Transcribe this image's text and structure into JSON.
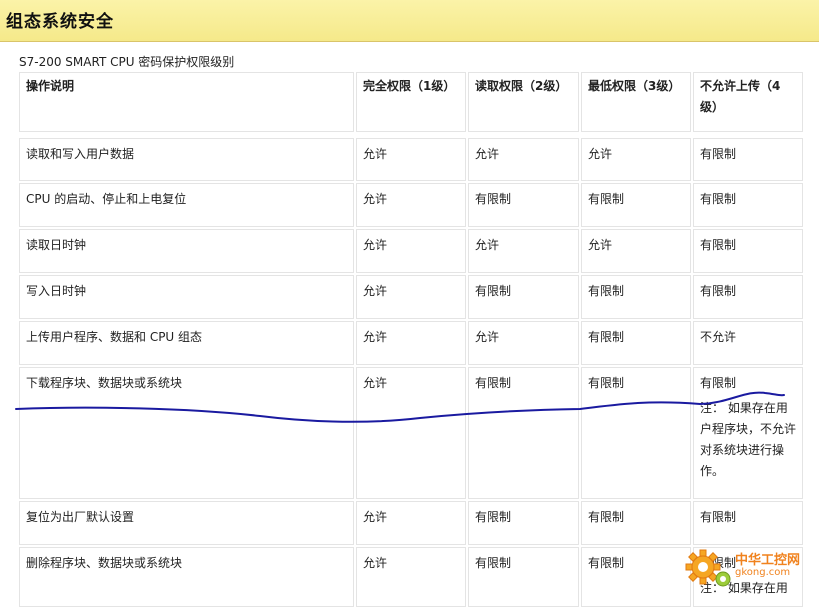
{
  "page": {
    "title": "组态系统安全",
    "subtitle": "S7-200 SMART CPU 密码保护权限级别"
  },
  "table": {
    "headers": [
      "操作说明",
      "完全权限（1级）",
      "读取权限（2级）",
      "最低权限（3级）",
      "不允许上传（4级）"
    ],
    "rows": [
      [
        "读取和写入用户数据",
        "允许",
        "允许",
        "允许",
        "有限制"
      ],
      [
        "CPU 的启动、停止和上电复位",
        "允许",
        "有限制",
        "有限制",
        "有限制"
      ],
      [
        "读取日时钟",
        "允许",
        "允许",
        "允许",
        "有限制"
      ],
      [
        "写入日时钟",
        "允许",
        "有限制",
        "有限制",
        "有限制"
      ],
      [
        "上传用户程序、数据和 CPU 组态",
        "允许",
        "允许",
        "有限制",
        "不允许"
      ],
      [
        "下载程序块、数据块或系统块",
        "允许",
        "有限制",
        "有限制",
        "有限制"
      ],
      [
        "复位为出厂默认设置",
        "允许",
        "有限制",
        "有限制",
        "有限制"
      ],
      [
        "删除程序块、数据块或系统块",
        "允许",
        "有限制",
        "有限制",
        "有限制"
      ]
    ],
    "notes": {
      "row6": "注： 如果存在用户程序块，不允许对系统块进行操作。",
      "row8": "注： 如果存在用"
    }
  },
  "watermark": {
    "name": "中华工控网",
    "url": "gkong.com",
    "color": "#f0821e"
  },
  "annotation": {
    "ink_color": "#1a1aa0"
  }
}
